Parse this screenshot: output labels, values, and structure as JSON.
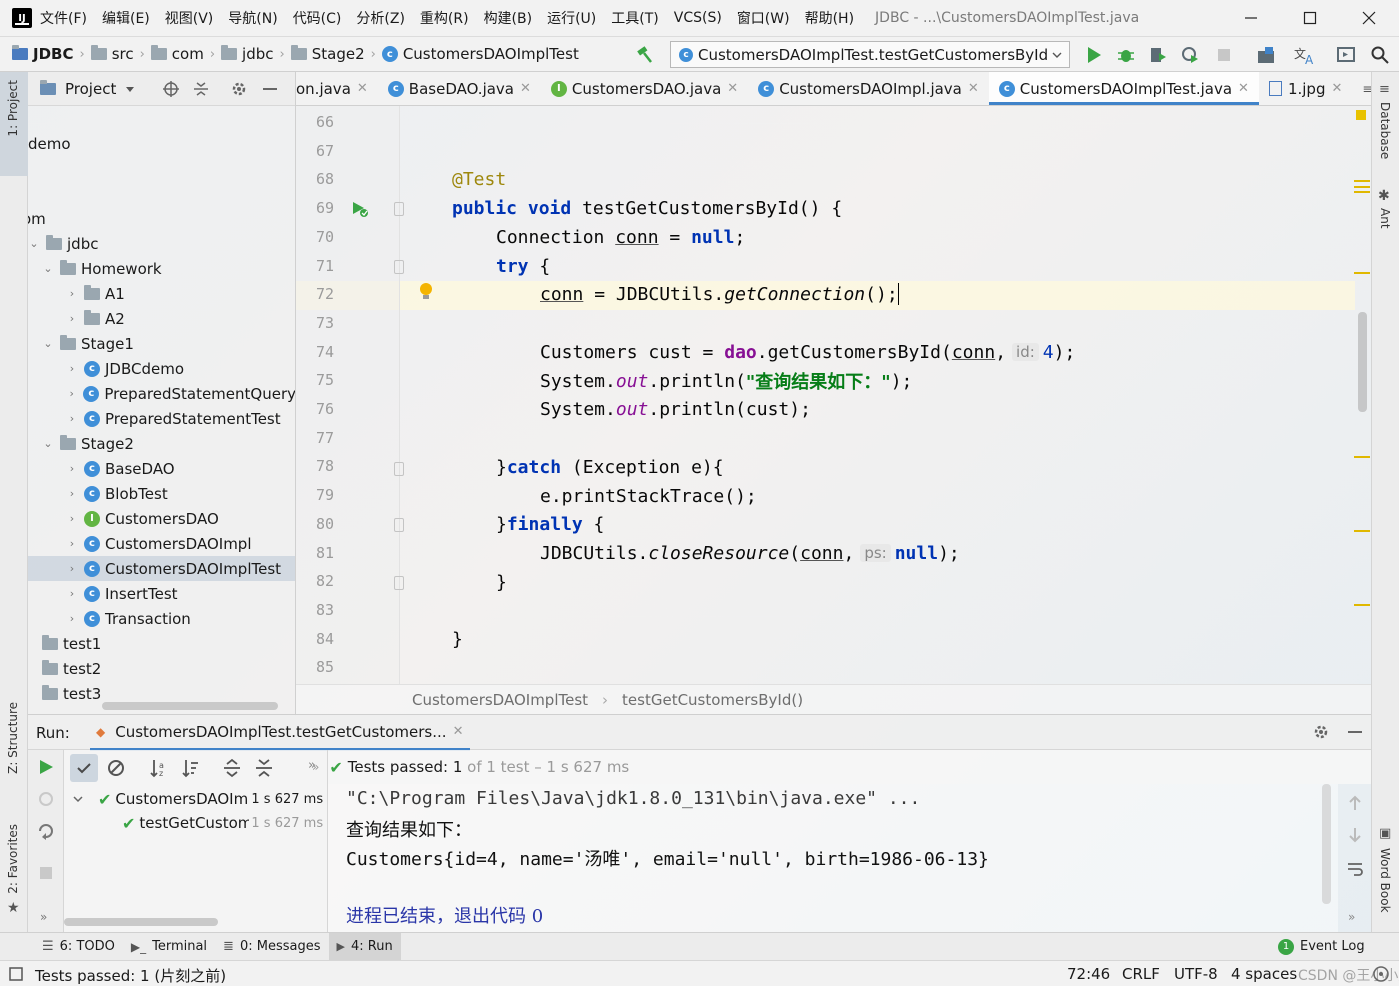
{
  "menubar": {
    "items": [
      "文件(F)",
      "编辑(E)",
      "视图(V)",
      "导航(N)",
      "代码(C)",
      "分析(Z)",
      "重构(R)",
      "构建(B)",
      "运行(U)",
      "工具(T)",
      "VCS(S)",
      "窗口(W)",
      "帮助(H)"
    ],
    "window_title": "JDBC - ...\\CustomersDAOImplTest.java"
  },
  "navbar": {
    "crumbs": [
      "JDBC",
      "src",
      "com",
      "jdbc",
      "Stage2",
      "CustomersDAOImplTest"
    ],
    "run_config": "CustomersDAOImplTest.testGetCustomersById"
  },
  "left_strip": {
    "project_tab": "1: Project",
    "structure_tab": "Z: Structure",
    "favorites_tab": "2: Favorites"
  },
  "right_strip": {
    "database_tab": "Database",
    "ant_tab": "Ant",
    "wordbook_tab": "Word Book"
  },
  "project_panel": {
    "title": "Project",
    "rows": [
      {
        "label": "demo",
        "icon": "none"
      },
      {
        "label": "om",
        "icon": "none"
      },
      {
        "label": "jdbc",
        "icon": "folder"
      },
      {
        "label": "Homework",
        "icon": "folder"
      },
      {
        "label": "A1",
        "icon": "folder"
      },
      {
        "label": "A2",
        "icon": "folder"
      },
      {
        "label": "Stage1",
        "icon": "folder"
      },
      {
        "label": "JDBCdemo",
        "icon": "class"
      },
      {
        "label": "PreparedStatementQuery",
        "icon": "class"
      },
      {
        "label": "PreparedStatementTest",
        "icon": "class"
      },
      {
        "label": "Stage2",
        "icon": "folder"
      },
      {
        "label": "BaseDAO",
        "icon": "class"
      },
      {
        "label": "BlobTest",
        "icon": "class"
      },
      {
        "label": "CustomersDAO",
        "icon": "interface"
      },
      {
        "label": "CustomersDAOImpl",
        "icon": "class"
      },
      {
        "label": "CustomersDAOImplTest",
        "icon": "class"
      },
      {
        "label": "InsertTest",
        "icon": "class"
      },
      {
        "label": "Transaction",
        "icon": "class"
      },
      {
        "label": "test1",
        "icon": "folder"
      },
      {
        "label": "test2",
        "icon": "folder"
      },
      {
        "label": "test3",
        "icon": "folder"
      }
    ]
  },
  "editor_tabs": [
    {
      "label": "on.java",
      "icon": "none"
    },
    {
      "label": "BaseDAO.java",
      "icon": "class"
    },
    {
      "label": "CustomersDAO.java",
      "icon": "interface"
    },
    {
      "label": "CustomersDAOImpl.java",
      "icon": "class"
    },
    {
      "label": "CustomersDAOImplTest.java",
      "icon": "class",
      "active": true
    },
    {
      "label": "1.jpg",
      "icon": "image"
    }
  ],
  "tab_overflow": "≡2",
  "editor": {
    "line_numbers": [
      "66",
      "67",
      "68",
      "69",
      "70",
      "71",
      "72",
      "73",
      "74",
      "75",
      "76",
      "77",
      "78",
      "79",
      "80",
      "81",
      "82",
      "83",
      "84",
      "85"
    ],
    "annotation": "@Test",
    "kw_public": "public",
    "kw_void": "void",
    "method_sig": " testGetCustomersById() {",
    "l70_type": "Connection ",
    "l70_var": "conn",
    "l70_eq": " = ",
    "kw_null": "null",
    "semi": ";",
    "kw_try": "try",
    "brace_open": " {",
    "l72_var": "conn",
    "l72_eq": " = JDBCUtils.",
    "l72_call": "getConnection",
    "l72_end": "();",
    "l74_a": "Customers cust = ",
    "l74_dao": "dao",
    "l74_b": ".getCustomersById(",
    "l74_conn": "conn",
    "l74_comma": ",",
    "l74_hint": "id:",
    "l74_val": "4",
    "l74_end": ");",
    "l75_a": "System.",
    "out": "out",
    "l75_b": ".println(",
    "l75_str": "\"查询结果如下：\"",
    "l75_end": ");",
    "l76_a": "System.",
    "l76_b": ".println(cust);",
    "l78_a": "}",
    "kw_catch": "catch",
    "l78_b": " (Exception e){",
    "l79": "e.printStackTrace();",
    "l80_a": "}",
    "kw_finally": "finally",
    "l80_b": " {",
    "l81_a": "JDBCUtils.",
    "l81_call": "closeResource",
    "l81_b": "(",
    "l81_conn": "conn",
    "l81_comma": ",",
    "l81_hint": "ps:",
    "l81_end": ");",
    "close_brace": "}"
  },
  "breadcrumb": {
    "class": "CustomersDAOImplTest",
    "method": "testGetCustomersById()"
  },
  "run": {
    "label": "Run:",
    "tab": "CustomersDAOImplTest.testGetCustomers...",
    "status_prefix": "Tests passed:",
    "status_count": "1",
    "status_rest": "of 1 test – 1 s 627 ms",
    "tree": [
      {
        "label": "CustomersDAOIm|",
        "time": "1 s 627 ms"
      },
      {
        "label": "testGetCustom",
        "time": "1 s 627 ms"
      }
    ],
    "console": [
      "\"C:\\Program Files\\Java\\jdk1.8.0_131\\bin\\java.exe\" ...",
      "查询结果如下：",
      "Customers{id=4, name='汤唯', email='null', birth=1986-06-13}",
      "",
      "进程已结束，退出代码 0"
    ]
  },
  "toolwindows": [
    {
      "label": "6: TODO"
    },
    {
      "label": "Terminal"
    },
    {
      "label": "0: Messages"
    },
    {
      "label": "4: Run",
      "active": true
    }
  ],
  "event_log": {
    "count": "1",
    "label": "Event Log"
  },
  "statusbar": {
    "message": "Tests passed: 1 (片刻之前)",
    "position": "72:46",
    "line_sep": "CRLF",
    "encoding": "UTF-8",
    "indent": "4 spaces"
  },
  "watermark": "CSDN @王小小鹏",
  "colors": {
    "accent": "#4083c9",
    "keyword": "#0033b3",
    "field": "#871094",
    "string": "#067d17",
    "annotation": "#9e880d",
    "pass": "#3aa545"
  }
}
